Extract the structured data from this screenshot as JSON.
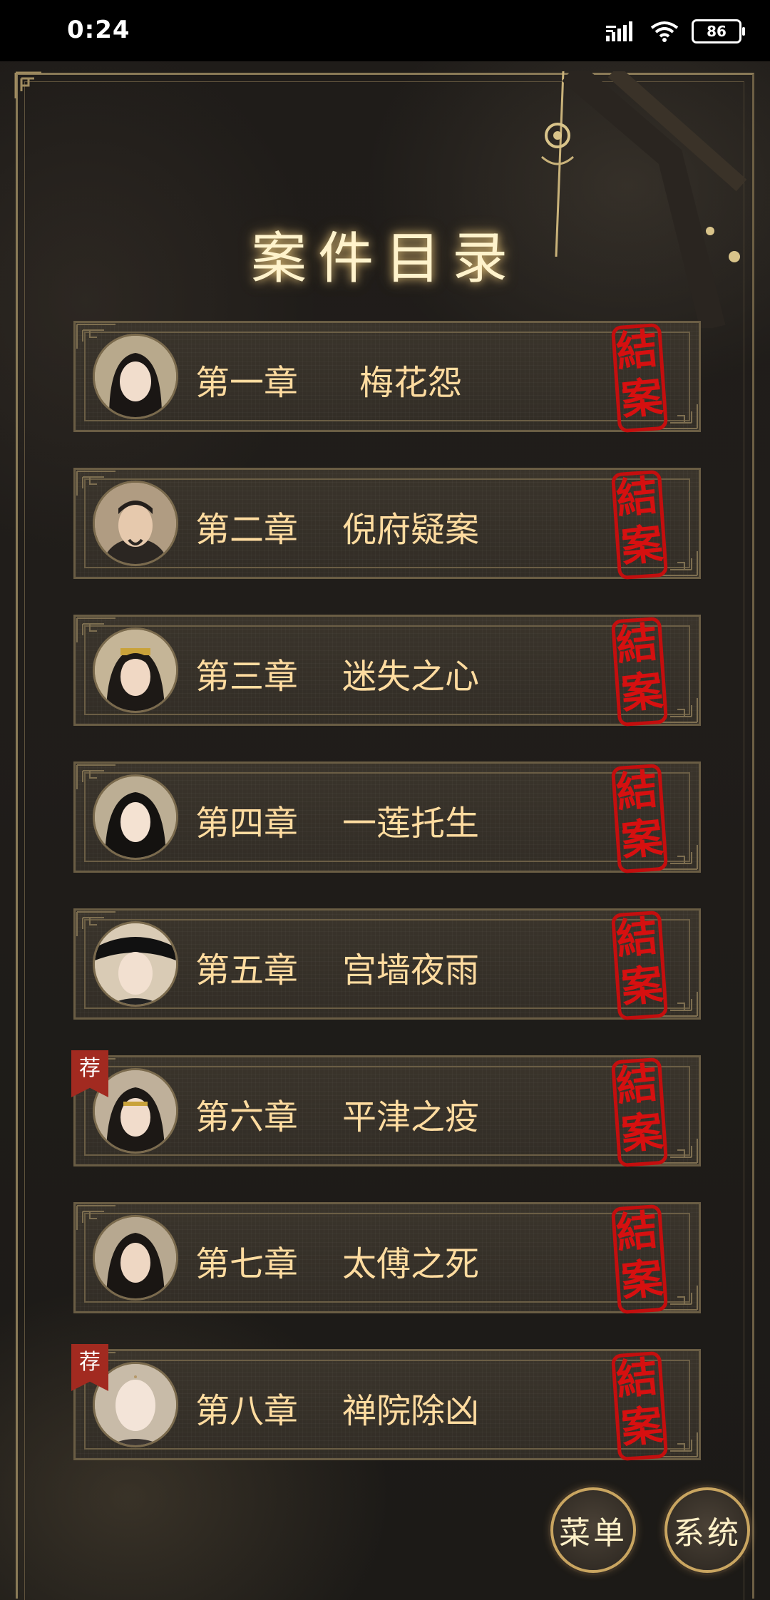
{
  "status_bar": {
    "time": "0:24",
    "battery": "86",
    "icons": [
      "signal-icon",
      "wifi-icon",
      "battery-icon"
    ]
  },
  "title": "案件目录",
  "colors": {
    "gold_text": "#ffdca0",
    "seal_red": "#d61010",
    "frame": "#6a5d44"
  },
  "chapters": [
    {
      "number": "第一章",
      "name": "梅花怨",
      "seal": "結案",
      "recommended": false
    },
    {
      "number": "第二章",
      "name": "倪府疑案",
      "seal": "結案",
      "recommended": false
    },
    {
      "number": "第三章",
      "name": "迷失之心",
      "seal": "結案",
      "recommended": false
    },
    {
      "number": "第四章",
      "name": "一莲托生",
      "seal": "結案",
      "recommended": false
    },
    {
      "number": "第五章",
      "name": "宫墙夜雨",
      "seal": "結案",
      "recommended": false
    },
    {
      "number": "第六章",
      "name": "平津之疫",
      "seal": "結案",
      "recommended": true,
      "badge": "荐"
    },
    {
      "number": "第七章",
      "name": "太傅之死",
      "seal": "結案",
      "recommended": false
    },
    {
      "number": "第八章",
      "name": "禅院除凶",
      "seal": "結案",
      "recommended": true,
      "badge": "荐"
    }
  ],
  "buttons": {
    "menu": "菜单",
    "system": "系统"
  }
}
